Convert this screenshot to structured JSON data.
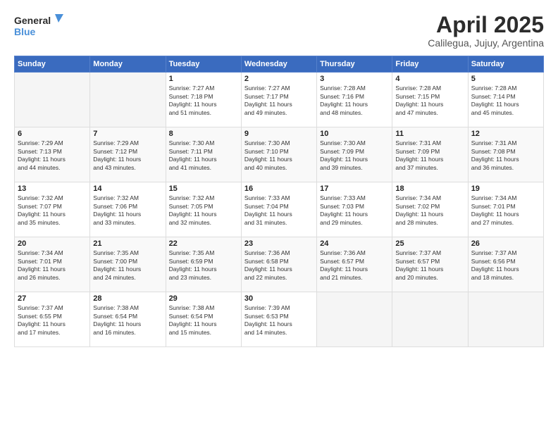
{
  "logo": {
    "line1": "General",
    "line2": "Blue"
  },
  "header": {
    "title": "April 2025",
    "subtitle": "Calilegua, Jujuy, Argentina"
  },
  "weekdays": [
    "Sunday",
    "Monday",
    "Tuesday",
    "Wednesday",
    "Thursday",
    "Friday",
    "Saturday"
  ],
  "weeks": [
    [
      {
        "day": "",
        "content": ""
      },
      {
        "day": "",
        "content": ""
      },
      {
        "day": "1",
        "content": "Sunrise: 7:27 AM\nSunset: 7:18 PM\nDaylight: 11 hours\nand 51 minutes."
      },
      {
        "day": "2",
        "content": "Sunrise: 7:27 AM\nSunset: 7:17 PM\nDaylight: 11 hours\nand 49 minutes."
      },
      {
        "day": "3",
        "content": "Sunrise: 7:28 AM\nSunset: 7:16 PM\nDaylight: 11 hours\nand 48 minutes."
      },
      {
        "day": "4",
        "content": "Sunrise: 7:28 AM\nSunset: 7:15 PM\nDaylight: 11 hours\nand 47 minutes."
      },
      {
        "day": "5",
        "content": "Sunrise: 7:28 AM\nSunset: 7:14 PM\nDaylight: 11 hours\nand 45 minutes."
      }
    ],
    [
      {
        "day": "6",
        "content": "Sunrise: 7:29 AM\nSunset: 7:13 PM\nDaylight: 11 hours\nand 44 minutes."
      },
      {
        "day": "7",
        "content": "Sunrise: 7:29 AM\nSunset: 7:12 PM\nDaylight: 11 hours\nand 43 minutes."
      },
      {
        "day": "8",
        "content": "Sunrise: 7:30 AM\nSunset: 7:11 PM\nDaylight: 11 hours\nand 41 minutes."
      },
      {
        "day": "9",
        "content": "Sunrise: 7:30 AM\nSunset: 7:10 PM\nDaylight: 11 hours\nand 40 minutes."
      },
      {
        "day": "10",
        "content": "Sunrise: 7:30 AM\nSunset: 7:09 PM\nDaylight: 11 hours\nand 39 minutes."
      },
      {
        "day": "11",
        "content": "Sunrise: 7:31 AM\nSunset: 7:09 PM\nDaylight: 11 hours\nand 37 minutes."
      },
      {
        "day": "12",
        "content": "Sunrise: 7:31 AM\nSunset: 7:08 PM\nDaylight: 11 hours\nand 36 minutes."
      }
    ],
    [
      {
        "day": "13",
        "content": "Sunrise: 7:32 AM\nSunset: 7:07 PM\nDaylight: 11 hours\nand 35 minutes."
      },
      {
        "day": "14",
        "content": "Sunrise: 7:32 AM\nSunset: 7:06 PM\nDaylight: 11 hours\nand 33 minutes."
      },
      {
        "day": "15",
        "content": "Sunrise: 7:32 AM\nSunset: 7:05 PM\nDaylight: 11 hours\nand 32 minutes."
      },
      {
        "day": "16",
        "content": "Sunrise: 7:33 AM\nSunset: 7:04 PM\nDaylight: 11 hours\nand 31 minutes."
      },
      {
        "day": "17",
        "content": "Sunrise: 7:33 AM\nSunset: 7:03 PM\nDaylight: 11 hours\nand 29 minutes."
      },
      {
        "day": "18",
        "content": "Sunrise: 7:34 AM\nSunset: 7:02 PM\nDaylight: 11 hours\nand 28 minutes."
      },
      {
        "day": "19",
        "content": "Sunrise: 7:34 AM\nSunset: 7:01 PM\nDaylight: 11 hours\nand 27 minutes."
      }
    ],
    [
      {
        "day": "20",
        "content": "Sunrise: 7:34 AM\nSunset: 7:01 PM\nDaylight: 11 hours\nand 26 minutes."
      },
      {
        "day": "21",
        "content": "Sunrise: 7:35 AM\nSunset: 7:00 PM\nDaylight: 11 hours\nand 24 minutes."
      },
      {
        "day": "22",
        "content": "Sunrise: 7:35 AM\nSunset: 6:59 PM\nDaylight: 11 hours\nand 23 minutes."
      },
      {
        "day": "23",
        "content": "Sunrise: 7:36 AM\nSunset: 6:58 PM\nDaylight: 11 hours\nand 22 minutes."
      },
      {
        "day": "24",
        "content": "Sunrise: 7:36 AM\nSunset: 6:57 PM\nDaylight: 11 hours\nand 21 minutes."
      },
      {
        "day": "25",
        "content": "Sunrise: 7:37 AM\nSunset: 6:57 PM\nDaylight: 11 hours\nand 20 minutes."
      },
      {
        "day": "26",
        "content": "Sunrise: 7:37 AM\nSunset: 6:56 PM\nDaylight: 11 hours\nand 18 minutes."
      }
    ],
    [
      {
        "day": "27",
        "content": "Sunrise: 7:37 AM\nSunset: 6:55 PM\nDaylight: 11 hours\nand 17 minutes."
      },
      {
        "day": "28",
        "content": "Sunrise: 7:38 AM\nSunset: 6:54 PM\nDaylight: 11 hours\nand 16 minutes."
      },
      {
        "day": "29",
        "content": "Sunrise: 7:38 AM\nSunset: 6:54 PM\nDaylight: 11 hours\nand 15 minutes."
      },
      {
        "day": "30",
        "content": "Sunrise: 7:39 AM\nSunset: 6:53 PM\nDaylight: 11 hours\nand 14 minutes."
      },
      {
        "day": "",
        "content": ""
      },
      {
        "day": "",
        "content": ""
      },
      {
        "day": "",
        "content": ""
      }
    ]
  ]
}
